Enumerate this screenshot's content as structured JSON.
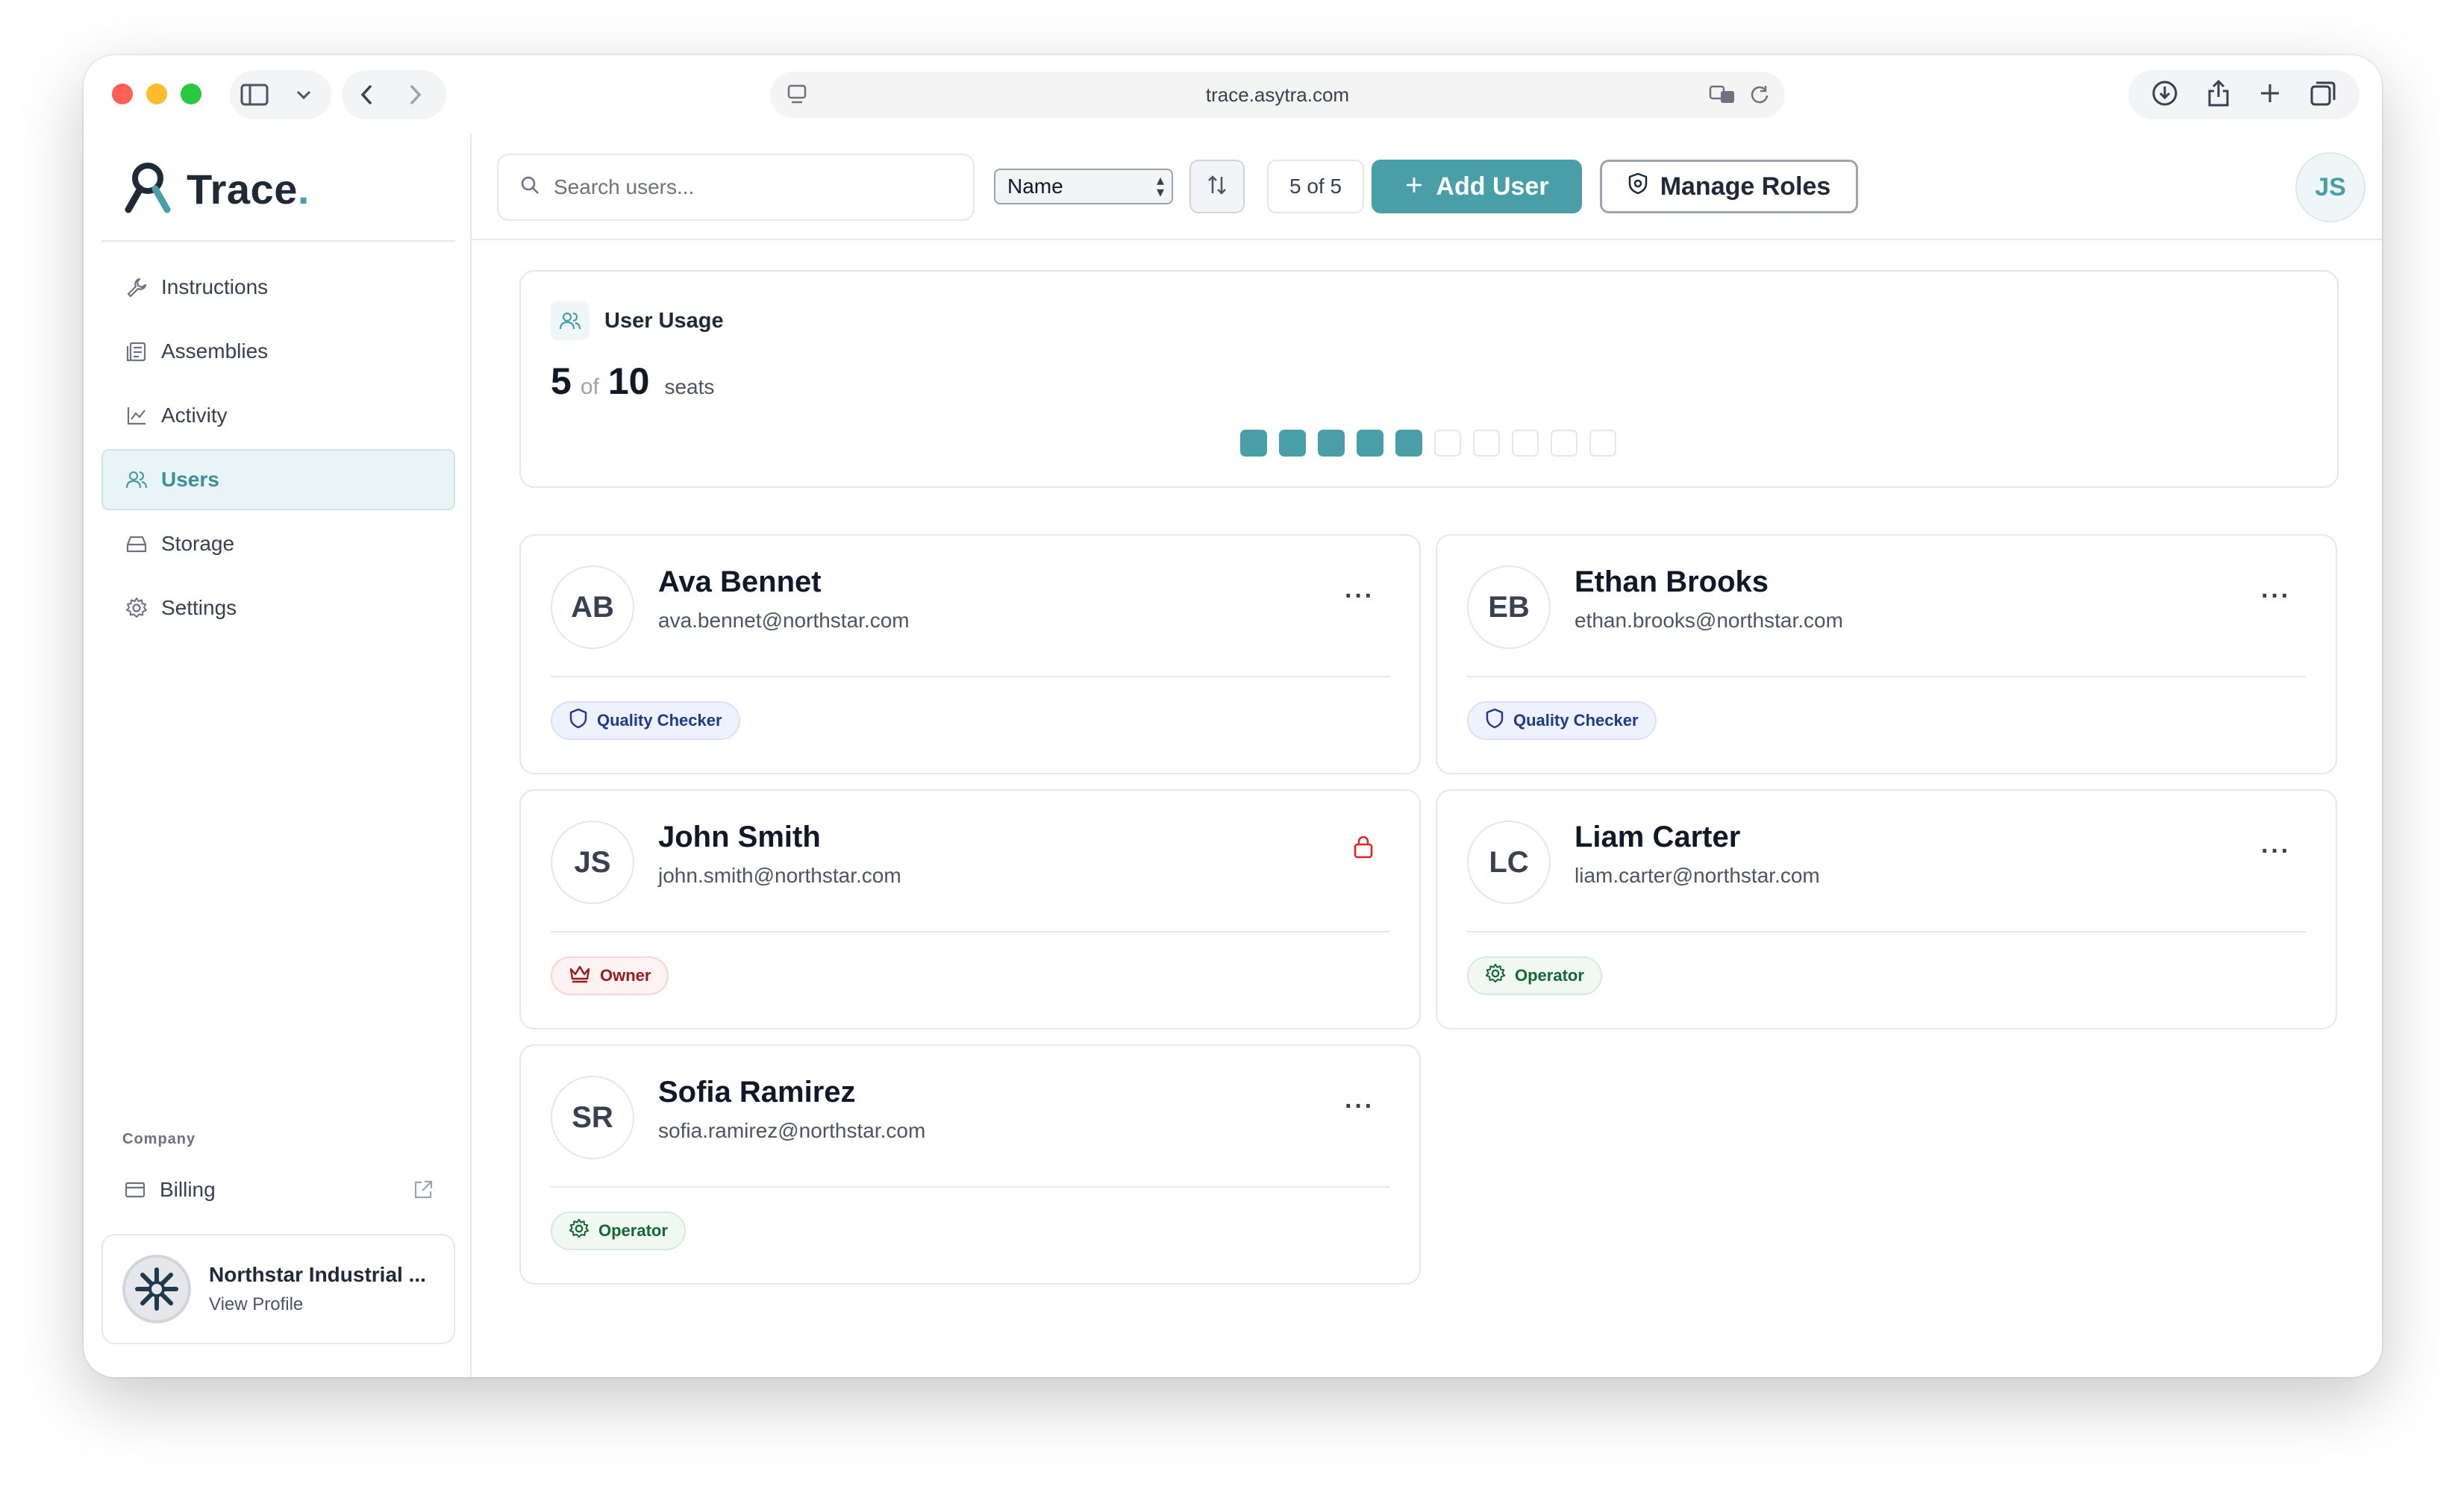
{
  "browser": {
    "url": "trace.asytra.com"
  },
  "brand": {
    "name": "Trace",
    "dot": "."
  },
  "nav": {
    "items": [
      {
        "label": "Instructions",
        "icon": "wrench-icon"
      },
      {
        "label": "Assemblies",
        "icon": "assemblies-icon"
      },
      {
        "label": "Activity",
        "icon": "chart-line-icon"
      },
      {
        "label": "Users",
        "icon": "users-icon",
        "active": true
      },
      {
        "label": "Storage",
        "icon": "storage-icon"
      },
      {
        "label": "Settings",
        "icon": "gear-icon"
      }
    ],
    "section_label": "Company",
    "billing_label": "Billing"
  },
  "profile": {
    "name": "Northstar Industrial ...",
    "link": "View Profile"
  },
  "toolbar": {
    "search_placeholder": "Search users...",
    "sort_field": "Name",
    "count": "5 of 5",
    "add_user": "Add User",
    "manage_roles": "Manage Roles",
    "current_user_initials": "JS"
  },
  "usage": {
    "title": "User Usage",
    "used": "5",
    "of": "of",
    "total": "10",
    "unit": "seats",
    "used_count": 5,
    "total_count": 10
  },
  "users": [
    {
      "initials": "AB",
      "name": "Ava Bennet",
      "email": "ava.bennet@northstar.com",
      "role": "Quality Checker",
      "role_style": "blue",
      "role_icon": "shield-icon",
      "action": "menu"
    },
    {
      "initials": "EB",
      "name": "Ethan Brooks",
      "email": "ethan.brooks@northstar.com",
      "role": "Quality Checker",
      "role_style": "blue",
      "role_icon": "shield-icon",
      "action": "menu"
    },
    {
      "initials": "JS",
      "name": "John Smith",
      "email": "john.smith@northstar.com",
      "role": "Owner",
      "role_style": "red",
      "role_icon": "crown-icon",
      "action": "lock"
    },
    {
      "initials": "LC",
      "name": "Liam Carter",
      "email": "liam.carter@northstar.com",
      "role": "Operator",
      "role_style": "green",
      "role_icon": "gear-icon",
      "action": "menu"
    },
    {
      "initials": "SR",
      "name": "Sofia Ramirez",
      "email": "sofia.ramirez@northstar.com",
      "role": "Operator",
      "role_style": "green",
      "role_icon": "gear-icon",
      "action": "menu"
    }
  ],
  "colors": {
    "accent": "#4a9ea8",
    "owner": "#991b1b",
    "quality_checker": "#1e3a8a",
    "operator": "#166534"
  }
}
